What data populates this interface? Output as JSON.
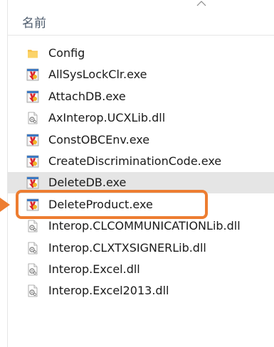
{
  "header": {
    "name_column": "名前",
    "sort_icon": "chevron-up-icon"
  },
  "files": [
    {
      "name": "Config",
      "icon": "folder-icon",
      "type": "folder",
      "selected": false
    },
    {
      "name": "AllSysLockClr.exe",
      "icon": "exe-app-icon",
      "type": "exe",
      "selected": false
    },
    {
      "name": "AttachDB.exe",
      "icon": "exe-app-icon",
      "type": "exe",
      "selected": false
    },
    {
      "name": "AxInterop.UCXLib.dll",
      "icon": "dll-file-icon",
      "type": "dll",
      "selected": false
    },
    {
      "name": "ConstOBCEnv.exe",
      "icon": "exe-app-icon",
      "type": "exe",
      "selected": false
    },
    {
      "name": "CreateDiscriminationCode.exe",
      "icon": "exe-app-icon",
      "type": "exe",
      "selected": false
    },
    {
      "name": "DeleteDB.exe",
      "icon": "exe-app-icon",
      "type": "exe",
      "selected": true
    },
    {
      "name": "DeleteProduct.exe",
      "icon": "exe-app-icon",
      "type": "exe",
      "selected": false
    },
    {
      "name": "Interop.CLCOMMUNICATIONLib.dll",
      "icon": "dll-file-icon",
      "type": "dll",
      "selected": false
    },
    {
      "name": "Interop.CLXTXSIGNERLib.dll",
      "icon": "dll-file-icon",
      "type": "dll",
      "selected": false
    },
    {
      "name": "Interop.Excel.dll",
      "icon": "dll-file-icon",
      "type": "dll",
      "selected": false
    },
    {
      "name": "Interop.Excel2013.dll",
      "icon": "dll-file-icon",
      "type": "dll",
      "selected": false
    }
  ],
  "colors": {
    "highlight": "#ed7d31",
    "selected_row": "#e5e5e5",
    "folder": "#f8c44f"
  }
}
